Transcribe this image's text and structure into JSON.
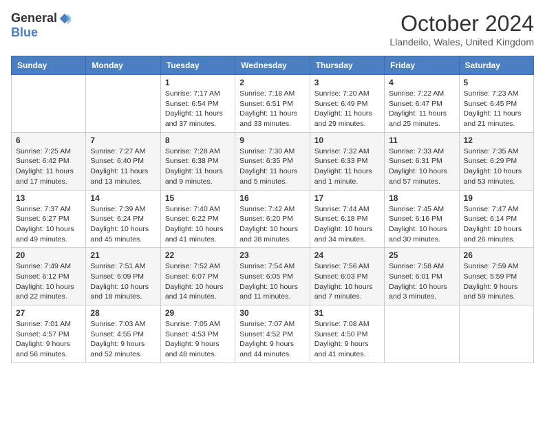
{
  "header": {
    "logo_general": "General",
    "logo_blue": "Blue",
    "title": "October 2024",
    "location": "Llandeilo, Wales, United Kingdom"
  },
  "weekdays": [
    "Sunday",
    "Monday",
    "Tuesday",
    "Wednesday",
    "Thursday",
    "Friday",
    "Saturday"
  ],
  "weeks": [
    [
      {
        "day": "",
        "info": ""
      },
      {
        "day": "",
        "info": ""
      },
      {
        "day": "1",
        "info": "Sunrise: 7:17 AM\nSunset: 6:54 PM\nDaylight: 11 hours and 37 minutes."
      },
      {
        "day": "2",
        "info": "Sunrise: 7:18 AM\nSunset: 6:51 PM\nDaylight: 11 hours and 33 minutes."
      },
      {
        "day": "3",
        "info": "Sunrise: 7:20 AM\nSunset: 6:49 PM\nDaylight: 11 hours and 29 minutes."
      },
      {
        "day": "4",
        "info": "Sunrise: 7:22 AM\nSunset: 6:47 PM\nDaylight: 11 hours and 25 minutes."
      },
      {
        "day": "5",
        "info": "Sunrise: 7:23 AM\nSunset: 6:45 PM\nDaylight: 11 hours and 21 minutes."
      }
    ],
    [
      {
        "day": "6",
        "info": "Sunrise: 7:25 AM\nSunset: 6:42 PM\nDaylight: 11 hours and 17 minutes."
      },
      {
        "day": "7",
        "info": "Sunrise: 7:27 AM\nSunset: 6:40 PM\nDaylight: 11 hours and 13 minutes."
      },
      {
        "day": "8",
        "info": "Sunrise: 7:28 AM\nSunset: 6:38 PM\nDaylight: 11 hours and 9 minutes."
      },
      {
        "day": "9",
        "info": "Sunrise: 7:30 AM\nSunset: 6:35 PM\nDaylight: 11 hours and 5 minutes."
      },
      {
        "day": "10",
        "info": "Sunrise: 7:32 AM\nSunset: 6:33 PM\nDaylight: 11 hours and 1 minute."
      },
      {
        "day": "11",
        "info": "Sunrise: 7:33 AM\nSunset: 6:31 PM\nDaylight: 10 hours and 57 minutes."
      },
      {
        "day": "12",
        "info": "Sunrise: 7:35 AM\nSunset: 6:29 PM\nDaylight: 10 hours and 53 minutes."
      }
    ],
    [
      {
        "day": "13",
        "info": "Sunrise: 7:37 AM\nSunset: 6:27 PM\nDaylight: 10 hours and 49 minutes."
      },
      {
        "day": "14",
        "info": "Sunrise: 7:39 AM\nSunset: 6:24 PM\nDaylight: 10 hours and 45 minutes."
      },
      {
        "day": "15",
        "info": "Sunrise: 7:40 AM\nSunset: 6:22 PM\nDaylight: 10 hours and 41 minutes."
      },
      {
        "day": "16",
        "info": "Sunrise: 7:42 AM\nSunset: 6:20 PM\nDaylight: 10 hours and 38 minutes."
      },
      {
        "day": "17",
        "info": "Sunrise: 7:44 AM\nSunset: 6:18 PM\nDaylight: 10 hours and 34 minutes."
      },
      {
        "day": "18",
        "info": "Sunrise: 7:45 AM\nSunset: 6:16 PM\nDaylight: 10 hours and 30 minutes."
      },
      {
        "day": "19",
        "info": "Sunrise: 7:47 AM\nSunset: 6:14 PM\nDaylight: 10 hours and 26 minutes."
      }
    ],
    [
      {
        "day": "20",
        "info": "Sunrise: 7:49 AM\nSunset: 6:12 PM\nDaylight: 10 hours and 22 minutes."
      },
      {
        "day": "21",
        "info": "Sunrise: 7:51 AM\nSunset: 6:09 PM\nDaylight: 10 hours and 18 minutes."
      },
      {
        "day": "22",
        "info": "Sunrise: 7:52 AM\nSunset: 6:07 PM\nDaylight: 10 hours and 14 minutes."
      },
      {
        "day": "23",
        "info": "Sunrise: 7:54 AM\nSunset: 6:05 PM\nDaylight: 10 hours and 11 minutes."
      },
      {
        "day": "24",
        "info": "Sunrise: 7:56 AM\nSunset: 6:03 PM\nDaylight: 10 hours and 7 minutes."
      },
      {
        "day": "25",
        "info": "Sunrise: 7:58 AM\nSunset: 6:01 PM\nDaylight: 10 hours and 3 minutes."
      },
      {
        "day": "26",
        "info": "Sunrise: 7:59 AM\nSunset: 5:59 PM\nDaylight: 9 hours and 59 minutes."
      }
    ],
    [
      {
        "day": "27",
        "info": "Sunrise: 7:01 AM\nSunset: 4:57 PM\nDaylight: 9 hours and 56 minutes."
      },
      {
        "day": "28",
        "info": "Sunrise: 7:03 AM\nSunset: 4:55 PM\nDaylight: 9 hours and 52 minutes."
      },
      {
        "day": "29",
        "info": "Sunrise: 7:05 AM\nSunset: 4:53 PM\nDaylight: 9 hours and 48 minutes."
      },
      {
        "day": "30",
        "info": "Sunrise: 7:07 AM\nSunset: 4:52 PM\nDaylight: 9 hours and 44 minutes."
      },
      {
        "day": "31",
        "info": "Sunrise: 7:08 AM\nSunset: 4:50 PM\nDaylight: 9 hours and 41 minutes."
      },
      {
        "day": "",
        "info": ""
      },
      {
        "day": "",
        "info": ""
      }
    ]
  ]
}
